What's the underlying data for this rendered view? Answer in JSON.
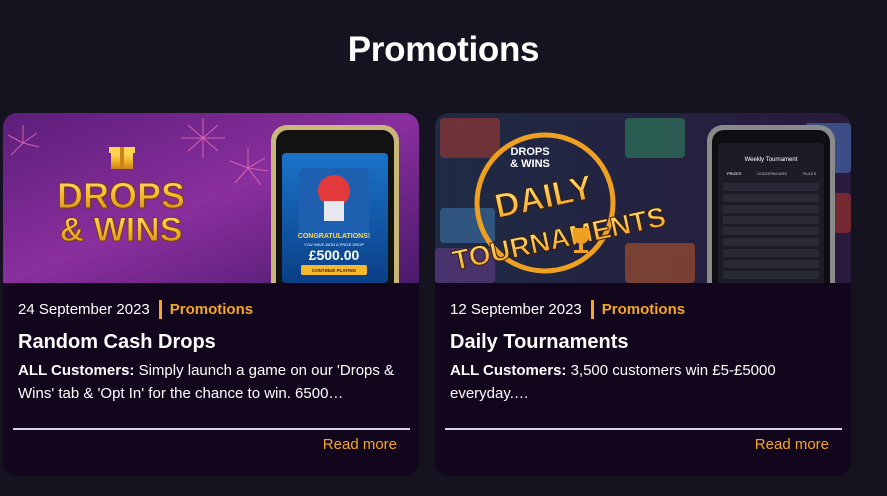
{
  "page": {
    "title": "Promotions"
  },
  "colors": {
    "background": "#15131f",
    "card": "#12061d",
    "accent": "#f5a623"
  },
  "cards": [
    {
      "image_text": {
        "brand_line1": "DROPS",
        "brand_amp": "&",
        "brand_line2": "WINS",
        "phone_msg": "CONGRATULATIONS!",
        "phone_sub": "YOU HAVE WON A PRIZE DROP",
        "phone_amount": "£500.00",
        "phone_button": "CONTINUE PLAYING"
      },
      "date": "24 September 2023",
      "category": "Promotions",
      "title": "Random Cash Drops",
      "excerpt_lead": "ALL Customers:",
      "excerpt_body": " Simply launch a game on our 'Drops & Wins' tab & 'Opt In' for the chance to win. 6500…",
      "read_more": "Read more"
    },
    {
      "image_text": {
        "badge_line1": "DROPS",
        "badge_line2": "& WINS",
        "headline_line1": "DAILY",
        "headline_line2": "TOURNAMENTS",
        "phone_title": "Weekly Tournament",
        "phone_tab1": "PRIZES",
        "phone_tab2": "LEADERBOARD",
        "phone_tab3": "RULES"
      },
      "date": "12 September 2023",
      "category": "Promotions",
      "title": "Daily Tournaments",
      "excerpt_lead": "ALL Customers:",
      "excerpt_body": " 3,500 customers win £5-£5000 everyday.…",
      "read_more": "Read more"
    }
  ]
}
